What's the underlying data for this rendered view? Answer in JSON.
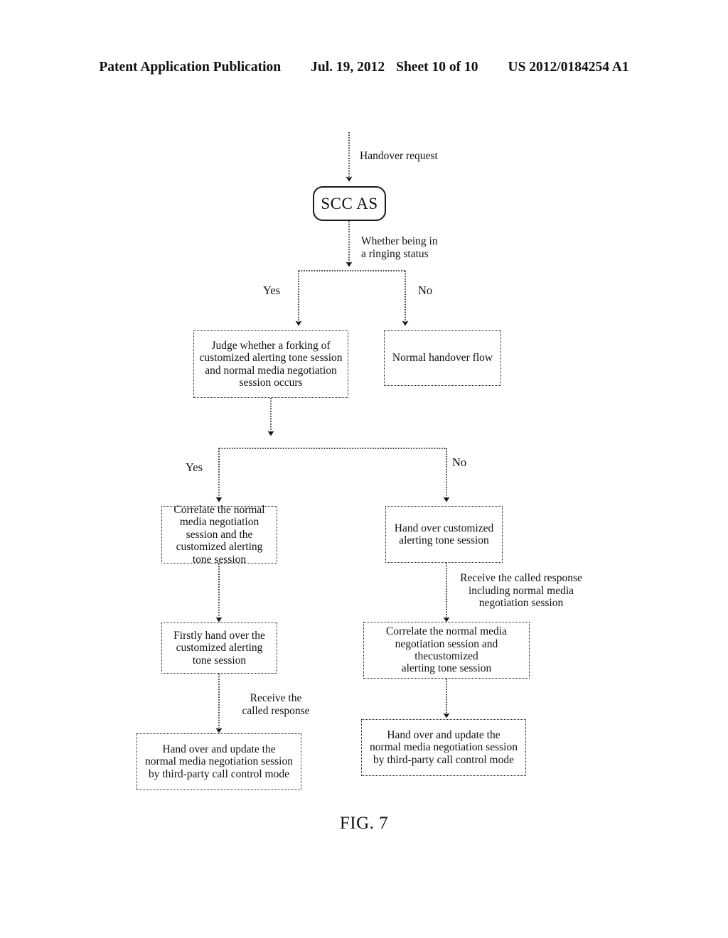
{
  "header": {
    "publication": "Patent Application Publication",
    "date": "Jul. 19, 2012",
    "sheet": "Sheet 10 of 10",
    "patent_number": "US 2012/0184254 A1"
  },
  "figure": {
    "caption": "FIG. 7"
  },
  "flowchart": {
    "nodes": {
      "scc_as": "SCC AS",
      "judge_forking": "Judge whether a forking of\ncustomized alerting tone session\nand normal media negotiation\nsession occurs",
      "normal_handover_flow": "Normal handover flow",
      "correlate_left": "Correlate the normal\nmedia negotiation\nsession and the\ncustomized alerting\ntone session",
      "hand_over_cat": "Hand over customized\nalerting tone session",
      "firstly_hand_over": "Firstly hand over the\ncustomized alerting\ntone session",
      "correlate_right": "Correlate the normal media\nnegotiation session and\nthecustomized\nalerting tone session",
      "update_left": "Hand over and update the\nnormal media negotiation session\nby third-party call control mode",
      "update_right": "Hand over and update the\nnormal media negotiation session\nby  third-party call control mode"
    },
    "edge_labels": {
      "handover_request": "Handover request",
      "ringing_status": "Whether being in\na ringing status",
      "called_response_full": "Receive the called response\nincluding normal media\nnegotiation session",
      "called_response_short": "Receive the\ncalled response"
    },
    "branch_labels": {
      "yes_1": "Yes",
      "no_1": "No",
      "yes_2": "Yes",
      "no_2": "No"
    }
  }
}
